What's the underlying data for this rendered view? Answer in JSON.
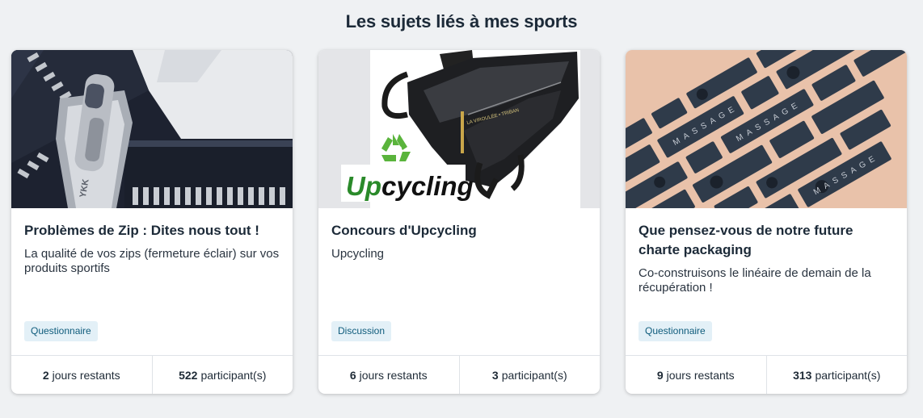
{
  "section": {
    "title": "Les sujets liés à mes sports"
  },
  "cards": [
    {
      "title": "Problèmes de Zip : Dites nous tout !",
      "description": "La qualité de vos zips (fermeture éclair) sur vos produits sportifs",
      "tag": "Questionnaire",
      "days_value": "2",
      "days_label": "jours restants",
      "participants_value": "522",
      "participants_label": "participant(s)",
      "image_text": "YKK",
      "image_icon": "zipper-photo"
    },
    {
      "title": "Concours d'Upcycling",
      "description": "Upcycling",
      "tag": "Discussion",
      "days_value": "6",
      "days_label": "jours restants",
      "participants_value": "3",
      "participants_label": "participant(s)",
      "image_text": "Upcycling",
      "image_icon": "recycle-icon"
    },
    {
      "title": "Que pensez-vous de notre future charte packaging",
      "description": "Co-construisons le linéaire de demain de la récupération !",
      "tag": "Questionnaire",
      "days_value": "9",
      "days_label": "jours restants",
      "participants_value": "313",
      "participants_label": "participant(s)",
      "image_text": "MASSAGE",
      "image_icon": "packaging-photo"
    }
  ],
  "colors": {
    "background": "#eff1f3",
    "tag_background": "#e3f0f7",
    "tag_text": "#0f5c7c",
    "recycle_green": "#5ab43c",
    "upcycling_green": "#2a8a2a"
  }
}
